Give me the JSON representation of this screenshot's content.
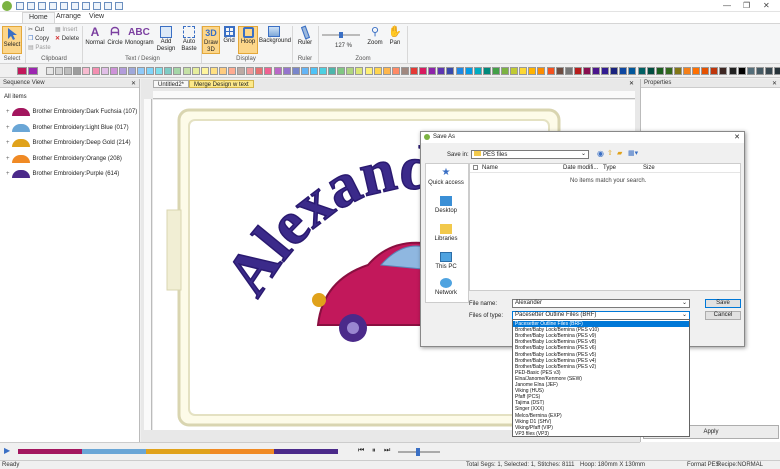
{
  "app": {
    "quick_access_icons": [
      "new-file-icon",
      "open-icon",
      "save-icon",
      "save-as-icon",
      "print-icon",
      "print-preview-icon",
      "undo-icon",
      "redo-icon",
      "export-icon",
      "pes-icon"
    ],
    "window_controls": {
      "minimize": "—",
      "restore": "❐",
      "close": "✕"
    }
  },
  "ribbon_tabs": [
    "Home",
    "Arrange",
    "View"
  ],
  "ribbon": {
    "select": "Select",
    "clipboard": {
      "cut": "Cut",
      "copy": "Copy",
      "paste": "Paste",
      "insert": "Insert",
      "delete": "Delete",
      "label": "Clipboard"
    },
    "text_design": {
      "normal": "Normal",
      "circle": "Circle",
      "monogram": "Monogram",
      "add_design": "Add Design",
      "auto_baste": "Auto Baste",
      "label": "Text / Design"
    },
    "display": {
      "draw3d": "Draw 3D",
      "grid": "Grid",
      "hoop": "Hoop",
      "background": "Background",
      "label": "Display"
    },
    "ruler": {
      "ruler": "Ruler",
      "label": "Ruler"
    },
    "zoom": {
      "value": "127 %",
      "zoom": "Zoom",
      "pan": "Pan",
      "label": "Zoom"
    },
    "select_label": "Select"
  },
  "colors": {
    "palette": [
      "#c2185b",
      "#9c27b0",
      "#e6e6e6",
      "#d4d4d4",
      "#bdbdbd",
      "#9e9e9e",
      "#f8bbd0",
      "#f48fb1",
      "#e1bee7",
      "#ce93d8",
      "#b39ddb",
      "#9fa8da",
      "#90caf9",
      "#81d4fa",
      "#80deea",
      "#80cbc4",
      "#a5d6a7",
      "#c5e1a5",
      "#e6ee9c",
      "#fff59d",
      "#ffe082",
      "#ffcc80",
      "#ffab91",
      "#bcaaa4",
      "#ef9a9a",
      "#e57373",
      "#f06292",
      "#ba68c8",
      "#9575cd",
      "#7986cb",
      "#64b5f6",
      "#4fc3f7",
      "#4dd0e1",
      "#4db6ac",
      "#81c784",
      "#aed581",
      "#dce775",
      "#fff176",
      "#ffd54f",
      "#ffb74d",
      "#ff8a65",
      "#a1887f",
      "#e53935",
      "#d81b60",
      "#8e24aa",
      "#5e35b1",
      "#3949ab",
      "#1e88e5",
      "#039be5",
      "#00acc1",
      "#00897b",
      "#43a047",
      "#7cb342",
      "#c0ca33",
      "#fdd835",
      "#ffb300",
      "#fb8c00",
      "#f4511e",
      "#6d4c41",
      "#757575",
      "#b71c1c",
      "#880e4f",
      "#4a148c",
      "#311b92",
      "#1a237e",
      "#0d47a1",
      "#01579b",
      "#006064",
      "#004d40",
      "#1b5e20",
      "#33691e",
      "#827717",
      "#f57f17",
      "#ff6f00",
      "#e65100",
      "#bf360c",
      "#3e2723",
      "#212121",
      "#000000",
      "#546e7a",
      "#455a64",
      "#37474f",
      "#263238"
    ],
    "accent": "#0078d7"
  },
  "sequence": {
    "title": "Sequence View",
    "root": "All items",
    "items": [
      {
        "label": "Brother Embroidery:Dark Fuchsia (107)",
        "color": "#a3165e"
      },
      {
        "label": "Brother Embroidery:Light Blue (017)",
        "color": "#6aa6d6"
      },
      {
        "label": "Brother Embroidery:Deep Gold (214)",
        "color": "#e0a21b"
      },
      {
        "label": "Brother Embroidery:Orange (208)",
        "color": "#f08a24"
      },
      {
        "label": "Brother Embroidery:Purple (614)",
        "color": "#4b2a8a"
      }
    ]
  },
  "doc_tabs": [
    "Untitled2*",
    "Merge Design w text"
  ],
  "properties": {
    "title": "Properties",
    "apply": "Apply"
  },
  "design": {
    "text": "Alexander",
    "text_color": "#3b2a8a",
    "car_color": "#c2185b",
    "window_color": "#6aa6d6",
    "wheel_color": "#4b2a8a"
  },
  "dialog": {
    "title": "Save As",
    "save_in_label": "Save in:",
    "save_in_value": "PES files",
    "columns": [
      "Name",
      "Date modifi...",
      "Type",
      "Size"
    ],
    "empty_text": "No items match your search.",
    "places": [
      "Quick access",
      "Desktop",
      "Libraries",
      "This PC",
      "Network"
    ],
    "file_name_label": "File name:",
    "file_name_value": "Alexander",
    "file_type_label": "Files of type:",
    "file_type_value": "Pacesetter Outline Files (BRF)",
    "save_button": "Save",
    "cancel_button": "Cancel",
    "file_types": [
      "Pacesetter Outline Files (BRF)",
      "Brother/Baby Lock/Bernina (PES v10)",
      "Brother/Baby Lock/Bernina (PES v9)",
      "Brother/Baby Lock/Bernina (PES v8)",
      "Brother/Baby Lock/Bernina (PES v6)",
      "Brother/Baby Lock/Bernina (PES v5)",
      "Brother/Baby Lock/Bernina (PES v4)",
      "Brother/Baby Lock/Bernina (PES v2)",
      "PED-Basic (PES v3)",
      "Elna/Janome/Kenmore (SEW)",
      "Janome Elna (JEF)",
      "Viking (HUS)",
      "Pfaff (PCS)",
      "Tajima (DST)",
      "Singer (XXX)",
      "Melco/Bernina (EXP)",
      "Viking D1 (SHV)",
      "Viking/Pfaff (VIP)",
      "VP3 files (VP3)"
    ]
  },
  "playbar": {
    "colors": [
      "#a3165e",
      "#6aa6d6",
      "#e0a21b",
      "#f08a24",
      "#4b2a8a"
    ]
  },
  "status": {
    "ready": "Ready",
    "segs": "Total Segs: 1, Selected: 1, Stitches: 8111",
    "hoop": "Hoop: 180mm X 130mm",
    "format": "Format PES",
    "recipe": "Recipe:NORMAL"
  }
}
